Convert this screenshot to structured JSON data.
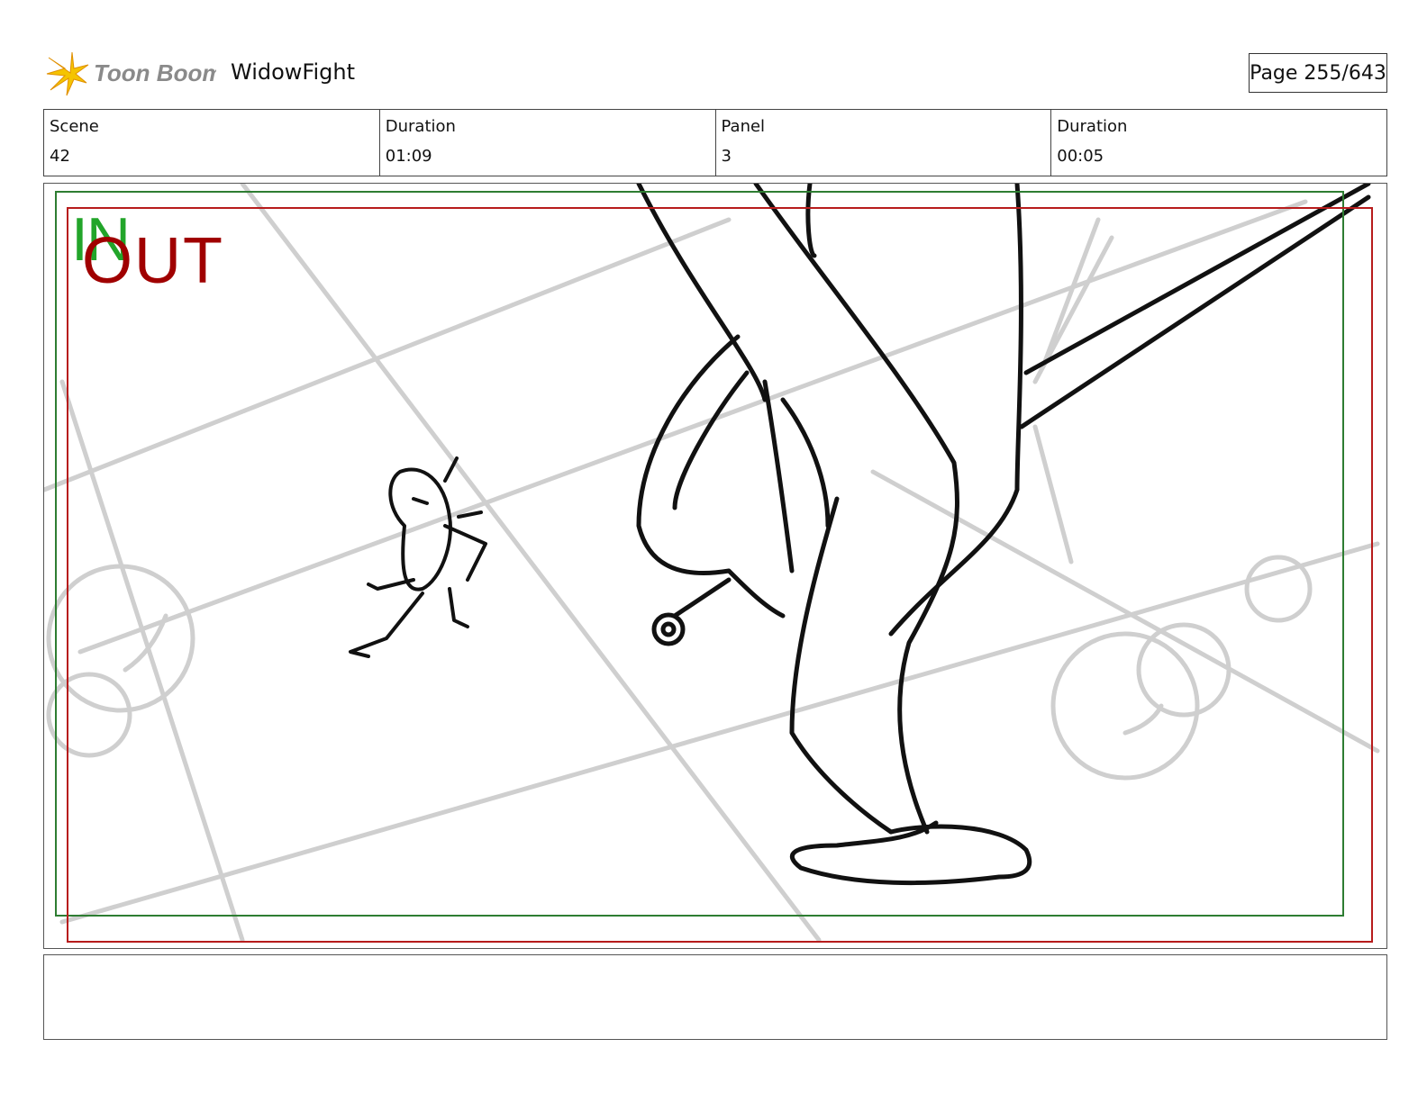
{
  "header": {
    "brand": "Toon Boom",
    "project_title": "WidowFight",
    "page_label": "Page 255/643"
  },
  "info": {
    "scene_label": "Scene",
    "scene_value": "42",
    "scene_duration_label": "Duration",
    "scene_duration_value": "01:09",
    "panel_label": "Panel",
    "panel_value": "3",
    "panel_duration_label": "Duration",
    "panel_duration_value": "00:05"
  },
  "panel": {
    "in_label": "IN",
    "out_label": "OUT",
    "in_color": "#22a52a",
    "out_color": "#a00000"
  },
  "dialog": {
    "text": ""
  }
}
